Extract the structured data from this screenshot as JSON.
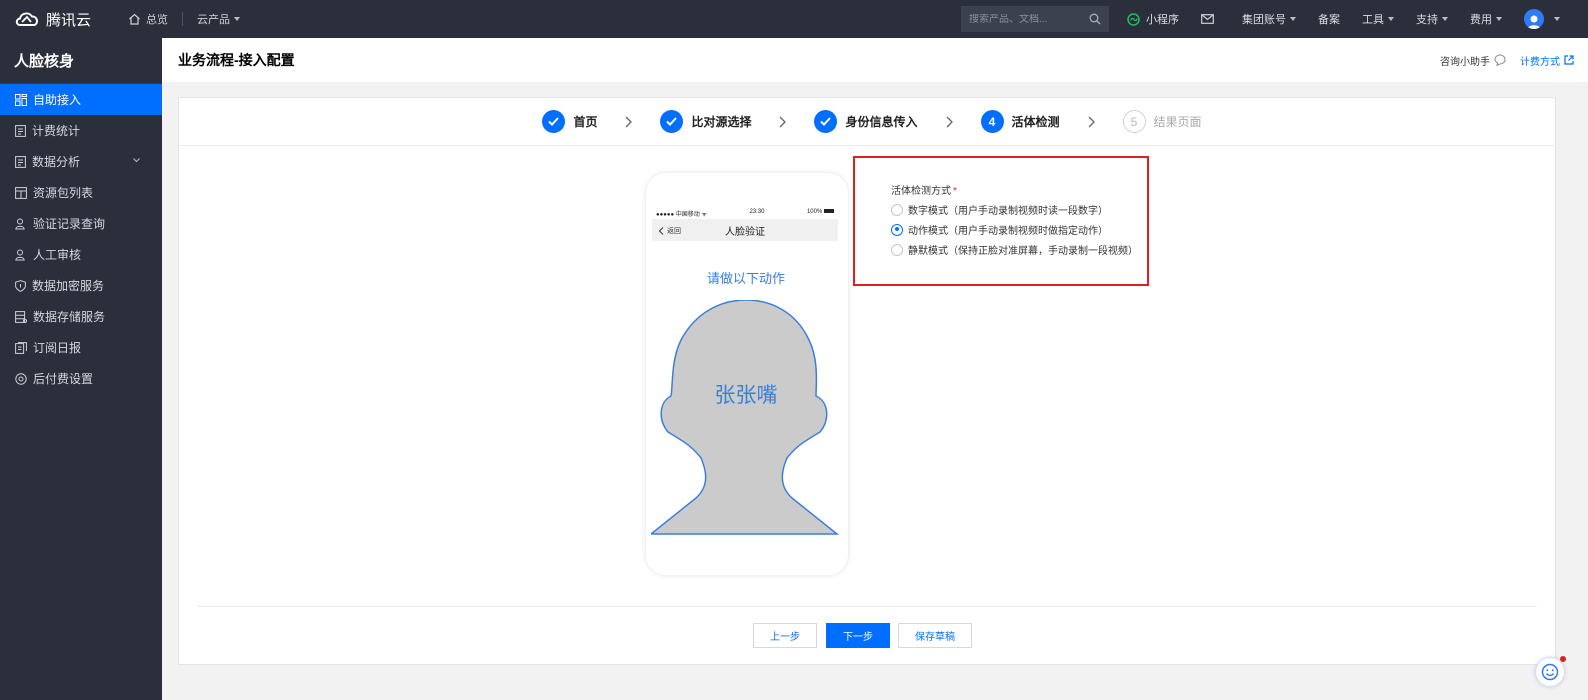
{
  "topbar": {
    "brand": "腾讯云",
    "overview": "总览",
    "products": "云产品",
    "search_placeholder": "搜索产品、文档...",
    "mini_program": "小程序",
    "group_account": "集团账号",
    "filing": "备案",
    "tools": "工具",
    "support": "支持",
    "billing": "费用"
  },
  "sidebar": {
    "title": "人脸核身",
    "items": [
      {
        "label": "自助接入"
      },
      {
        "label": "计费统计"
      },
      {
        "label": "数据分析"
      },
      {
        "label": "资源包列表"
      },
      {
        "label": "验证记录查询"
      },
      {
        "label": "人工审核"
      },
      {
        "label": "数据加密服务"
      },
      {
        "label": "数据存储服务"
      },
      {
        "label": "订阅日报"
      },
      {
        "label": "后付费设置"
      }
    ]
  },
  "header": {
    "title": "业务流程-接入配置",
    "assistant": "咨询小助手",
    "billing_link": "计费方式"
  },
  "steps": [
    {
      "label": "首页",
      "state": "done"
    },
    {
      "label": "比对源选择",
      "state": "done"
    },
    {
      "label": "身份信息传入",
      "state": "done"
    },
    {
      "label": "活体检测",
      "number": "4",
      "state": "current"
    },
    {
      "label": "结果页面",
      "number": "5",
      "state": "pending"
    }
  ],
  "phone": {
    "carrier": "●●●●● 中国移动 ᯤ",
    "time": "23:30",
    "battery": "100%",
    "back": "返回",
    "nav_title": "人脸验证",
    "prompt": "请做以下动作",
    "head_label": "张张嘴"
  },
  "liveness": {
    "label": "活体检测方式",
    "required_mark": "*",
    "options": [
      {
        "label": "数字模式（用户手动录制视频时读一段数字）",
        "checked": false
      },
      {
        "label": "动作模式（用户手动录制视频时做指定动作）",
        "checked": true
      },
      {
        "label": "静默模式（保持正脸对准屏幕，手动录制一段视频）",
        "checked": false
      }
    ]
  },
  "footer": {
    "prev": "上一步",
    "next": "下一步",
    "save_draft": "保存草稿"
  },
  "colors": {
    "accent": "#006eff",
    "topbar_bg": "#2a2f3b",
    "highlight_border": "#e0201c"
  }
}
